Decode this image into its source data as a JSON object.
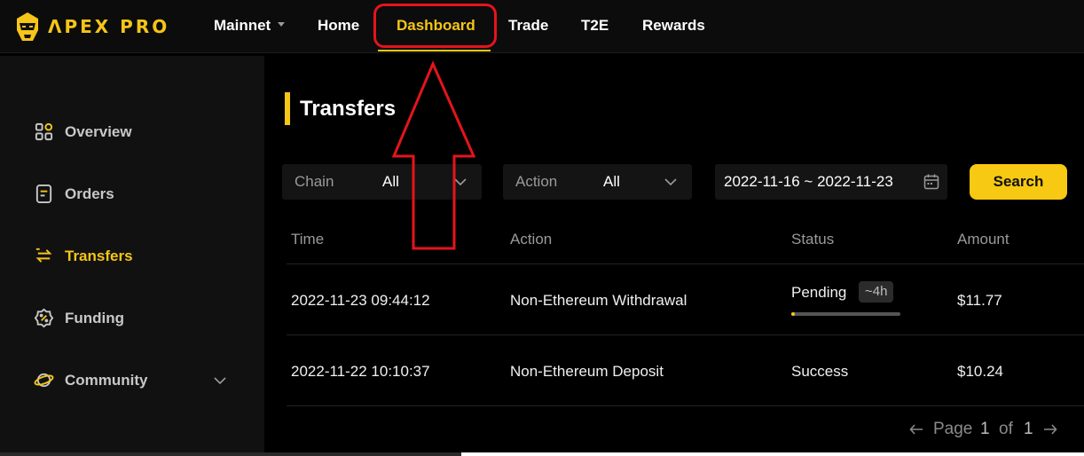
{
  "brand": {
    "name": "ΛPEX PRO",
    "accent_color": "#f5c518"
  },
  "nav": {
    "network": "Mainnet",
    "items": [
      {
        "label": "Home"
      },
      {
        "label": "Dashboard",
        "active": true
      },
      {
        "label": "Trade"
      },
      {
        "label": "T2E"
      },
      {
        "label": "Rewards"
      }
    ]
  },
  "sidebar": {
    "items": [
      {
        "label": "Overview",
        "icon": "grid-icon"
      },
      {
        "label": "Orders",
        "icon": "document-icon"
      },
      {
        "label": "Transfers",
        "icon": "transfer-icon",
        "active": true
      },
      {
        "label": "Funding",
        "icon": "percent-badge-icon"
      },
      {
        "label": "Community",
        "icon": "planet-icon",
        "expandable": true
      }
    ]
  },
  "main": {
    "title": "Transfers",
    "filters": {
      "chain": {
        "label": "Chain",
        "value": "All"
      },
      "action": {
        "label": "Action",
        "value": "All"
      },
      "date_range": "2022-11-16 ~ 2022-11-23",
      "search_label": "Search"
    },
    "table": {
      "columns": [
        "Time",
        "Action",
        "Status",
        "Amount"
      ],
      "rows": [
        {
          "time": "2022-11-23 09:44:12",
          "action": "Non-Ethereum Withdrawal",
          "status": "Pending",
          "eta": "~4h",
          "progress": 0.03,
          "amount": "$11.77"
        },
        {
          "time": "2022-11-22 10:10:37",
          "action": "Non-Ethereum Deposit",
          "status": "Success",
          "amount": "$10.24"
        }
      ]
    },
    "pagination": {
      "prefix": "Page",
      "current": "1",
      "separator": "of",
      "total": "1",
      "prev_icon": "arrow-left-icon",
      "next_icon": "arrow-right-icon"
    }
  },
  "annotation": {
    "color": "#e5141b"
  }
}
